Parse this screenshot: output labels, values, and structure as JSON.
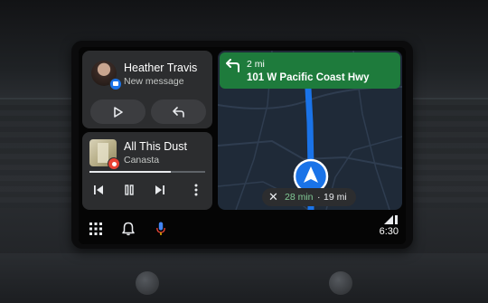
{
  "contact": {
    "name": "Heather Travis",
    "subtitle": "New message"
  },
  "media": {
    "title": "All This Dust",
    "artist": "Canasta",
    "progress_fraction": 0.7
  },
  "navigation": {
    "distance": "2 mi",
    "street": "101 W Pacific Coast Hwy",
    "eta_time": "28 min",
    "eta_separator": "·",
    "eta_distance": "19 mi"
  },
  "status": {
    "time": "6:30"
  },
  "icons": {
    "apps": "grid-icon",
    "notifications": "bell-icon",
    "assistant": "mic-icon"
  },
  "colors": {
    "nav_banner": "#1e7b3c",
    "route": "#1a73e8",
    "eta_time": "#81c995"
  }
}
